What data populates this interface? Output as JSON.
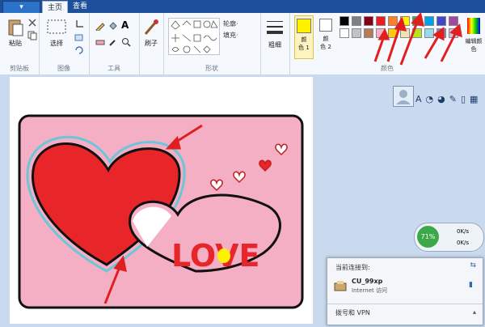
{
  "ribbon": {
    "file_label": "▾",
    "tabs": [
      {
        "label": "主页"
      },
      {
        "label": "查看"
      }
    ],
    "groups": {
      "clipboard": {
        "label": "剪贴板",
        "paste": "粘贴"
      },
      "image": {
        "label": "图像",
        "select": "选择"
      },
      "tools": {
        "label": "工具",
        "text_tool": "A"
      },
      "brushes": {
        "label": "刷子"
      },
      "shapes": {
        "label": "形状",
        "outline": "轮廓·",
        "fill": "填充·"
      },
      "size": {
        "label": "粗细"
      },
      "colors": {
        "label": "颜色",
        "color1": "颜\n色 1",
        "color2": "颜\n色 2",
        "edit": "编辑颜色"
      }
    },
    "palette": [
      "#000000",
      "#7f7f7f",
      "#880015",
      "#ed1c24",
      "#ff7f27",
      "#fff200",
      "#22b14c",
      "#00a2e8",
      "#3f48cc",
      "#a349a4",
      "#ffffff",
      "#c3c3c3",
      "#b97a57",
      "#ffaec9",
      "#ffc90e",
      "#efe4b0",
      "#b5e61d",
      "#99d9ea",
      "#7092be",
      "#c8bfe7"
    ],
    "color1_value": "#fff200",
    "color2_value": "#ffffff"
  },
  "canvas": {
    "text": "LOVE",
    "background": "#f5afc5",
    "heart_red": "#e8262a",
    "text_color": "#e8262a",
    "dot_color": "#fff200"
  },
  "side_tools": {
    "items": [
      "A",
      "◔",
      "◕",
      "✎",
      "▯",
      "▦"
    ]
  },
  "widget": {
    "percent": "71%",
    "top_value": "0K/s",
    "bottom_value": "0K/s"
  },
  "network_popup": {
    "title": "当前连接到:",
    "network_name": "CU_99xp",
    "network_status": "Internet 访问",
    "section": "拨号和 VPN"
  }
}
